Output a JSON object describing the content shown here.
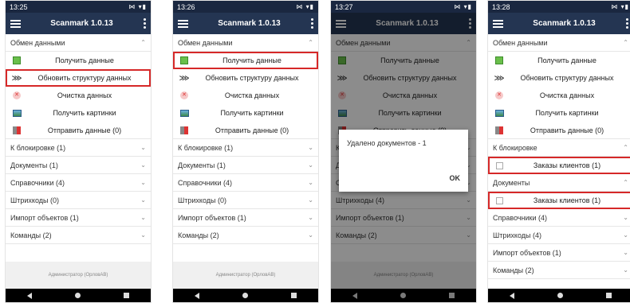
{
  "app": {
    "title": "Scanmark 1.0.13",
    "footer_user": "Администратор (ОрловАВ)",
    "colors": {
      "appbar": "#243552",
      "statusbar": "#1a2740",
      "highlight": "#d62828"
    }
  },
  "phones": [
    {
      "time": "13:25"
    },
    {
      "time": "13:26"
    },
    {
      "time": "13:27"
    },
    {
      "time": "13:28"
    }
  ],
  "status_icons": "⚙ ◎ ○",
  "right_status": "⋈ ▾▮",
  "sections": {
    "exchange": "Обмен данными",
    "lock": "К блокировке (1)",
    "lock_open": "К блокировке",
    "docs": "Документы (1)",
    "docs_open": "Документы",
    "refs": "Справочники (4)",
    "barcodes": "Штрихкоды (0)",
    "barcodes4": "Штрихкоды (4)",
    "import": "Импорт объектов (1)",
    "commands": "Команды (2)"
  },
  "exchange_items": {
    "get": "Получить данные",
    "update": "Обновить структуру данных",
    "clear": "Очистка данных",
    "pictures": "Получить картинки",
    "send": "Отправить данные (0)"
  },
  "orders": "Заказы клиентов (1)",
  "dialog": {
    "message": "Удалено документов - 1",
    "ok": "OK"
  },
  "icons": {
    "expand": "⌃",
    "collapse": "⌄"
  }
}
